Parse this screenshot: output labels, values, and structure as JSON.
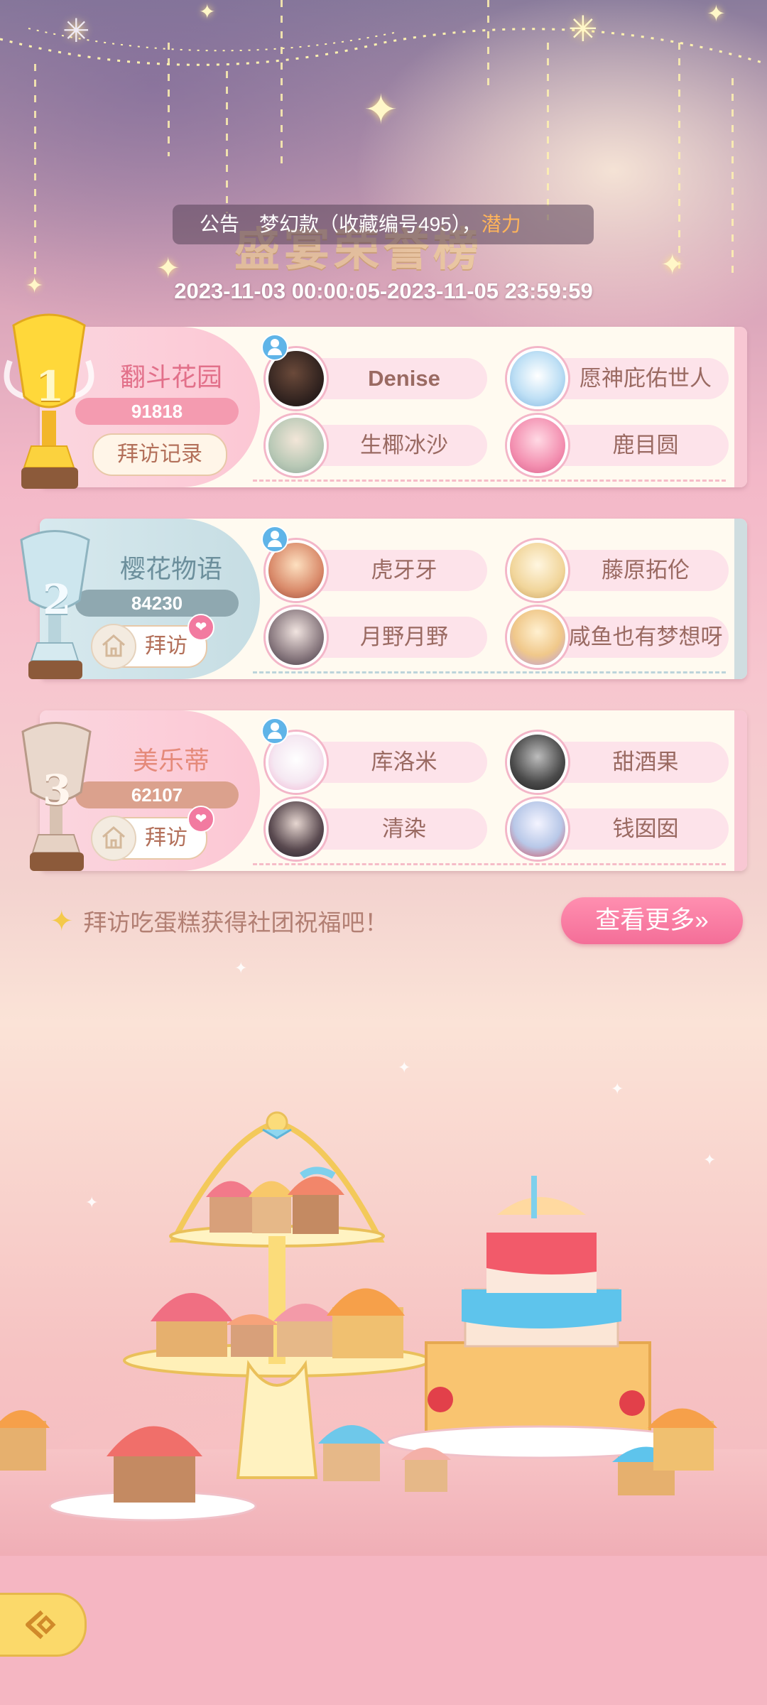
{
  "announcement": {
    "label": "公告",
    "message_prefix": "梦幻款（收藏编号495），",
    "message_highlight": "潜力"
  },
  "board": {
    "title": "盛宴荣誉榜",
    "period": "2023-11-03 00:00:05-2023-11-05 23:59:59"
  },
  "clubs": [
    {
      "rank": "1",
      "name": "翻斗花园",
      "score": "91818",
      "button": "拜访记录",
      "members": [
        "Denise",
        "愿神庇佑世人",
        "生椰冰沙",
        "鹿目圆"
      ]
    },
    {
      "rank": "2",
      "name": "樱花物语",
      "score": "84230",
      "button": "拜访",
      "members": [
        "虎牙牙",
        "藤原拓伦",
        "月野月野",
        "咸鱼也有梦想呀"
      ]
    },
    {
      "rank": "3",
      "name": "美乐蒂",
      "score": "62107",
      "button": "拜访",
      "members": [
        "库洛米",
        "甜酒果",
        "清染",
        "钱囡囡"
      ]
    }
  ],
  "hint": "拜访吃蛋糕获得社团祝福吧！",
  "more_button": "查看更多»",
  "colors": {
    "accent_pink": "#f46e98",
    "gold": "#f4c94a"
  },
  "icons": {
    "back": "back-arrow-icon",
    "home": "home-icon",
    "heart": "heart-icon",
    "leader": "leader-icon"
  }
}
